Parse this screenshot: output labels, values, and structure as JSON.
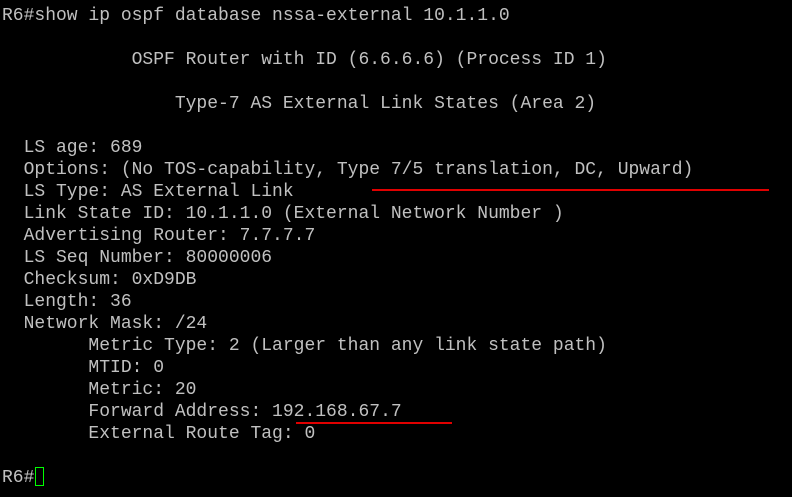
{
  "terminal": {
    "command_line": "R6#show ip ospf database nssa-external 10.1.1.0",
    "header_router": "            OSPF Router with ID (6.6.6.6) (Process ID 1)",
    "header_states": "                Type-7 AS External Link States (Area 2)",
    "ls_age": "  LS age: 689",
    "options_prefix": "  Options: (No TOS-capability, ",
    "options_highlight": "Type 7/5 translation, DC, Upward)",
    "ls_type": "  LS Type: AS External Link",
    "link_state_id": "  Link State ID: 10.1.1.0 (External Network Number )",
    "advertising_router": "  Advertising Router: 7.7.7.7",
    "ls_seq_number": "  LS Seq Number: 80000006",
    "checksum": "  Checksum: 0xD9DB",
    "length": "  Length: 36",
    "network_mask": "  Network Mask: /24",
    "metric_type": "        Metric Type: 2 (Larger than any link state path)",
    "mtid": "        MTID: 0",
    "metric": "        Metric: 20",
    "forward_address_label": "        Forward Address: ",
    "forward_address_value": "192.168.67.7",
    "external_route_tag": "        External Route Tag: 0",
    "prompt": "R6#"
  },
  "colors": {
    "background": "#000000",
    "text": "#c0c0c0",
    "annotation_underline": "#e00000",
    "cursor": "#00ff00"
  }
}
